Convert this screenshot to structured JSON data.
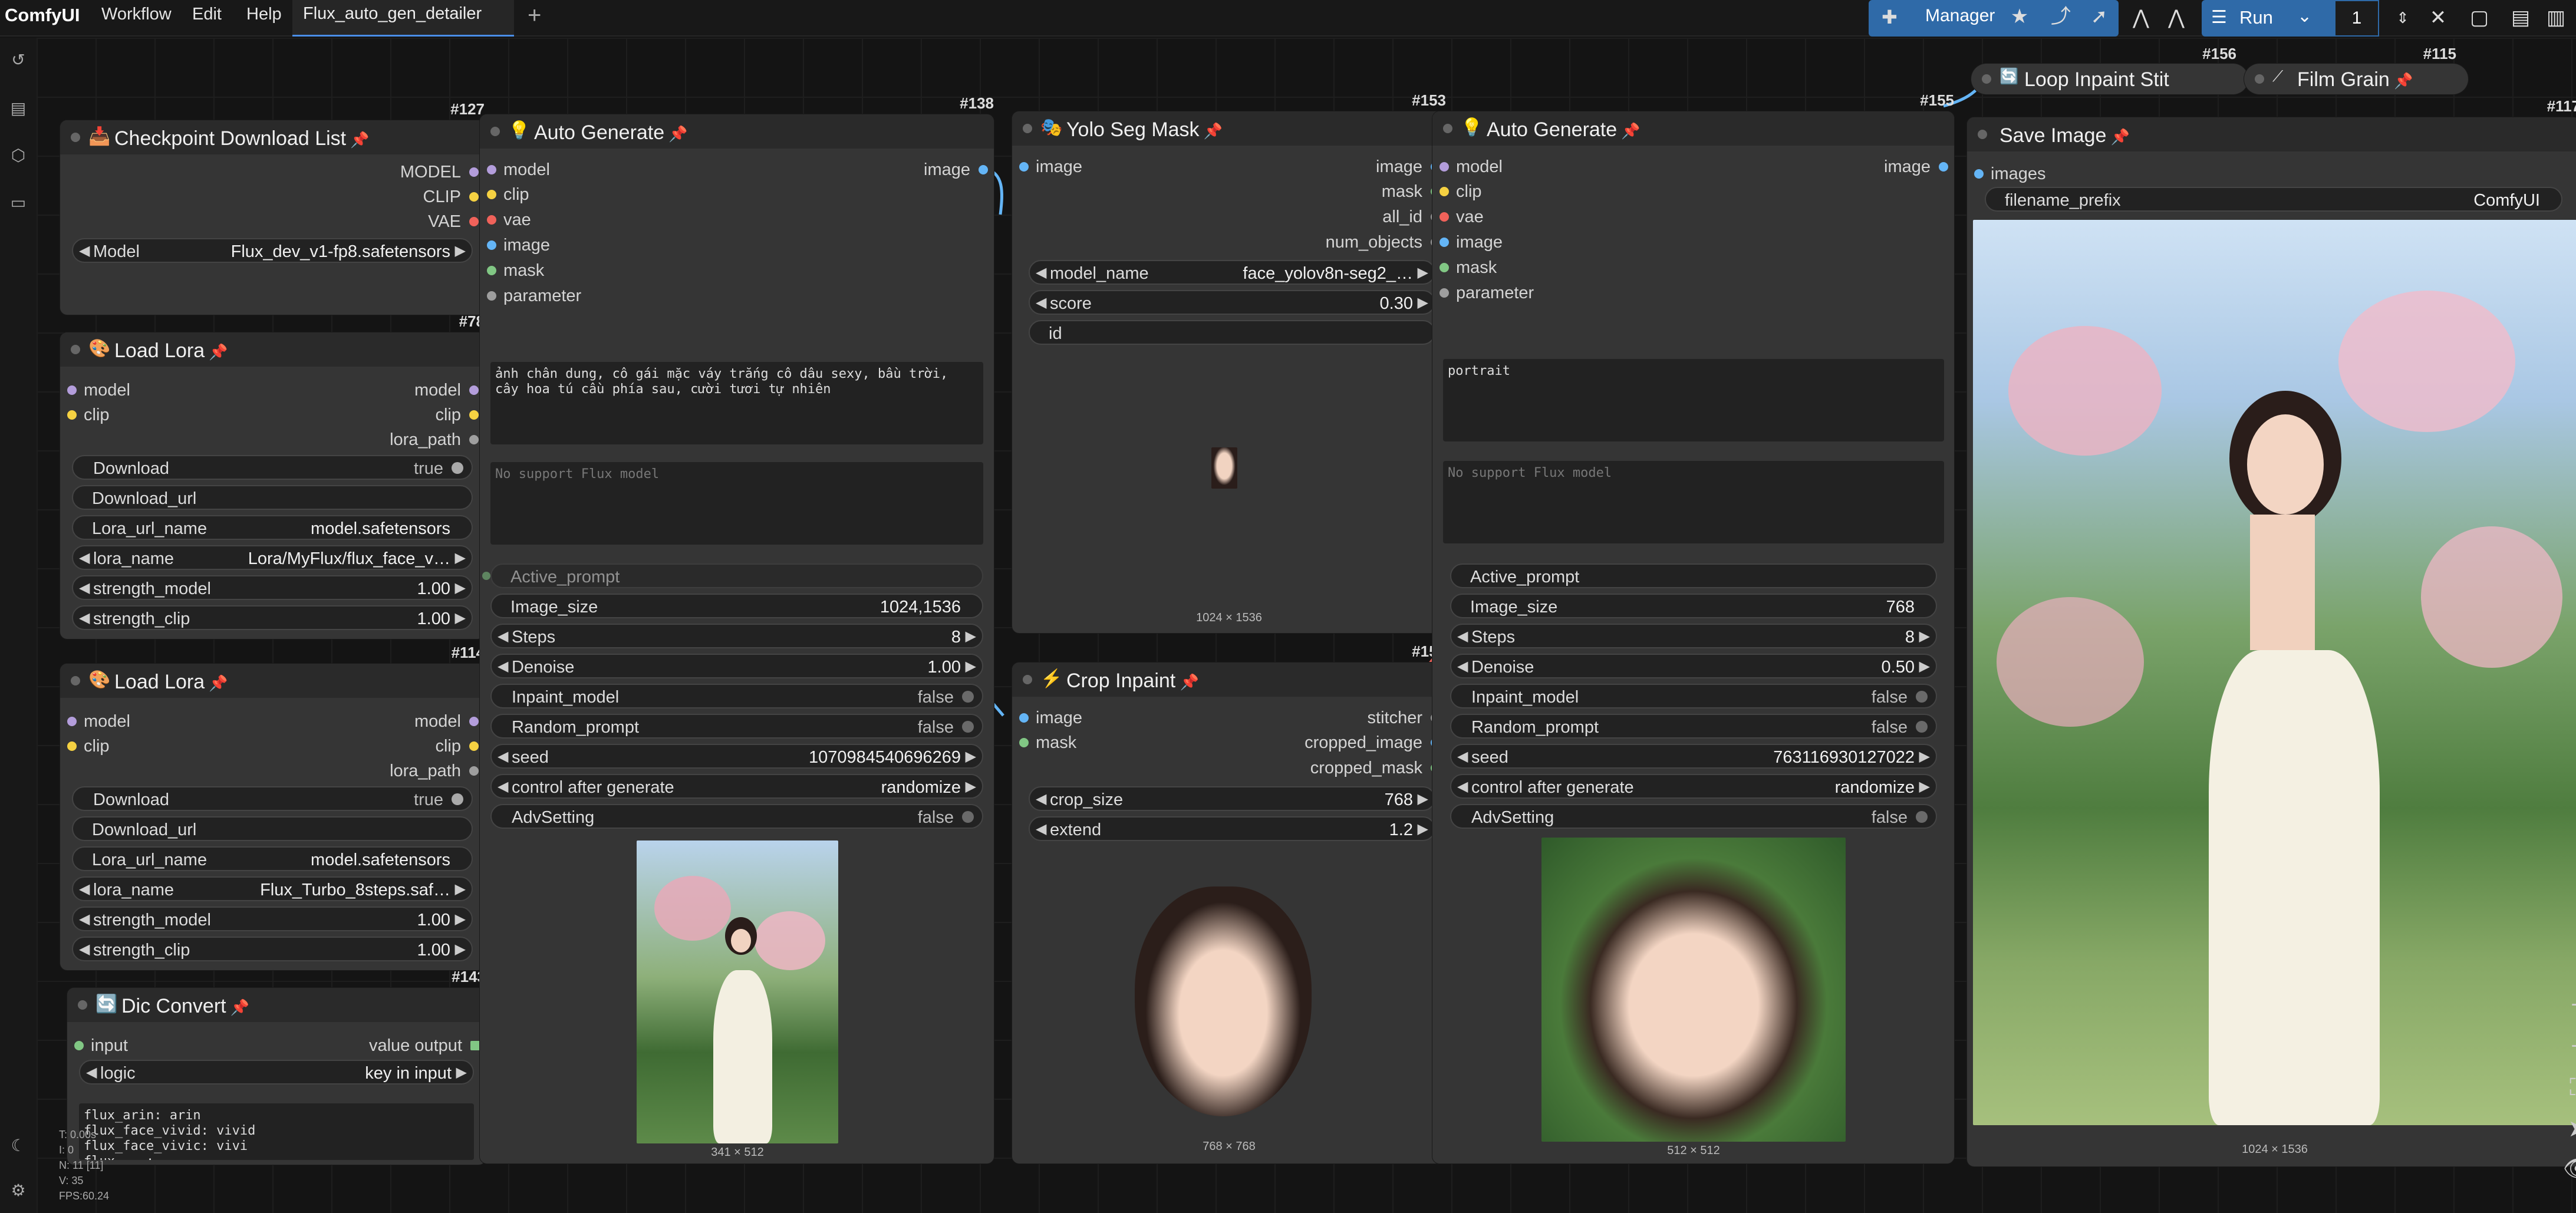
{
  "topbar": {
    "brand": "ComfyUI",
    "menu": [
      "Workflow",
      "Edit",
      "Help"
    ],
    "active_tab": "Flux_auto_gen_detailer",
    "manager_label": "Manager",
    "run_label": "Run",
    "run_count": "1"
  },
  "stats": {
    "t": "T: 0.00s",
    "i": "I: 0",
    "n": "N: 11 [11]",
    "v": "V: 35",
    "fps": "FPS:60.24"
  },
  "nodes": {
    "n127": {
      "id": "#127",
      "title": "Checkpoint Download List",
      "outputs": [
        "MODEL",
        "CLIP",
        "VAE"
      ],
      "model_label": "Model",
      "model_value": "Flux_dev_v1-fp8.safetensors"
    },
    "n78": {
      "id": "#78",
      "title": "Load Lora",
      "inputs": [
        "model",
        "clip"
      ],
      "outputs": [
        "model",
        "clip",
        "lora_path"
      ],
      "download_label": "Download",
      "download_value": "true",
      "download_url_label": "Download_url",
      "lora_url_name_label": "Lora_url_name",
      "lora_url_name_value": "model.safetensors",
      "lora_name_label": "lora_name",
      "lora_name_value": "Lora/MyFlux/flux_face_v…",
      "strength_model_label": "strength_model",
      "strength_model_value": "1.00",
      "strength_clip_label": "strength_clip",
      "strength_clip_value": "1.00"
    },
    "n114": {
      "id": "#114",
      "title": "Load Lora",
      "inputs": [
        "model",
        "clip"
      ],
      "outputs": [
        "model",
        "clip",
        "lora_path"
      ],
      "download_label": "Download",
      "download_value": "true",
      "download_url_label": "Download_url",
      "lora_url_name_label": "Lora_url_name",
      "lora_url_name_value": "model.safetensors",
      "lora_name_label": "lora_name",
      "lora_name_value": "Flux_Turbo_8steps.saf…",
      "strength_model_label": "strength_model",
      "strength_model_value": "1.00",
      "strength_clip_label": "strength_clip",
      "strength_clip_value": "1.00"
    },
    "n143": {
      "id": "#143",
      "title": "Dic Convert",
      "input": "input",
      "output": "value output",
      "logic_label": "logic",
      "logic_value": "key in input",
      "text": "flux_arin: arin\nflux_face_vivid: vivid\nflux_face_vivic: vivi\nflux_...: ..."
    },
    "n138": {
      "id": "#138",
      "title": "Auto Generate",
      "inputs": [
        "model",
        "clip",
        "vae",
        "image",
        "mask",
        "parameter"
      ],
      "output": "image",
      "prompt": "ảnh chân dung, cô gái mặc váy trắng cô dâu sexy, bầu trời, cây hoa tú cầu phía sau, cười tươi tự nhiên",
      "neg_placeholder": "No support Flux model",
      "active_prompt_label": "Active_prompt",
      "image_size_label": "Image_size",
      "image_size_value": "1024,1536",
      "steps_label": "Steps",
      "steps_value": "8",
      "denoise_label": "Denoise",
      "denoise_value": "1.00",
      "inpaint_label": "Inpaint_model",
      "inpaint_value": "false",
      "random_label": "Random_prompt",
      "random_value": "false",
      "seed_label": "seed",
      "seed_value": "1070984540696269",
      "control_label": "control after generate",
      "control_value": "randomize",
      "adv_label": "AdvSetting",
      "adv_value": "false",
      "img_caption": "341 × 512"
    },
    "n153": {
      "id": "#153",
      "title": "Yolo Seg Mask",
      "input": "image",
      "outputs": [
        "image",
        "mask",
        "all_id",
        "num_objects"
      ],
      "model_name_label": "model_name",
      "model_name_value": "face_yolov8n-seg2_…",
      "score_label": "score",
      "score_value": "0.30",
      "id_label": "id",
      "img_caption": "1024 × 1536"
    },
    "n154": {
      "id": "#154",
      "title": "Crop Inpaint",
      "inputs": [
        "image",
        "mask"
      ],
      "outputs": [
        "stitcher",
        "cropped_image",
        "cropped_mask"
      ],
      "crop_size_label": "crop_size",
      "crop_size_value": "768",
      "extend_label": "extend",
      "extend_value": "1.2",
      "img_caption": "768 × 768"
    },
    "n155": {
      "id": "#155",
      "title": "Auto Generate",
      "inputs": [
        "model",
        "clip",
        "vae",
        "image",
        "mask",
        "parameter"
      ],
      "output": "image",
      "prompt": "portrait",
      "neg_placeholder": "No support Flux model",
      "active_prompt_label": "Active_prompt",
      "image_size_label": "Image_size",
      "image_size_value": "768",
      "steps_label": "Steps",
      "steps_value": "8",
      "denoise_label": "Denoise",
      "denoise_value": "0.50",
      "inpaint_label": "Inpaint_model",
      "inpaint_value": "false",
      "random_label": "Random_prompt",
      "random_value": "false",
      "seed_label": "seed",
      "seed_value": "763116930127022",
      "control_label": "control after generate",
      "control_value": "randomize",
      "adv_label": "AdvSetting",
      "adv_value": "false",
      "img_caption": "512 × 512"
    },
    "n156": {
      "id": "#156",
      "title": "Loop Inpaint Stit"
    },
    "n115": {
      "id": "#115",
      "title": "Film Grain"
    },
    "n117": {
      "id": "#117",
      "title": "Save Image",
      "input": "images",
      "filename_label": "filename_prefix",
      "filename_value": "ComfyUI",
      "img_caption": "1024 × 1536"
    }
  },
  "colors": {
    "model": "#b39ddb",
    "clip": "#f5d142",
    "vae": "#f0625a",
    "image": "#64b5f6",
    "mask": "#81c784",
    "parameter": "#9e9e9e",
    "accent": "#2f6aa8"
  }
}
